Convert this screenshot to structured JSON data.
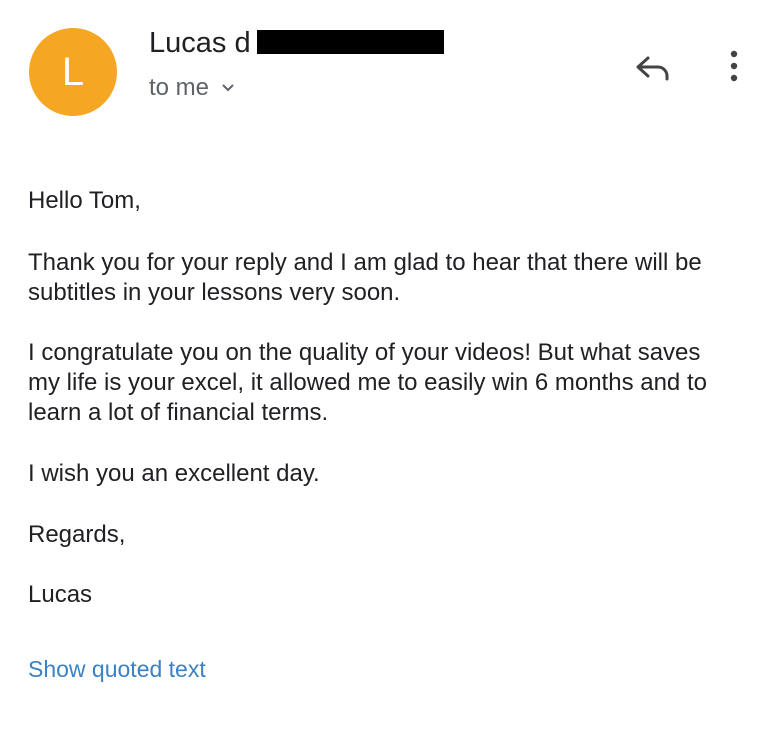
{
  "header": {
    "avatar_letter": "L",
    "avatar_color": "#f5a623",
    "sender_name_visible": "Lucas d",
    "recipient_label": "to me",
    "reply_icon": "reply-icon",
    "more_icon": "more-vertical-icon",
    "chevron_icon": "chevron-down-icon"
  },
  "message": {
    "greeting": "Hello Tom,",
    "paragraphs": [
      "Thank you for your reply and I am glad to hear that there will be subtitles in your lessons very soon.",
      "I congratulate you on the quality of your videos! But what saves my life is your excel, it allowed me to easily win 6 months and to learn a lot of financial terms.",
      "I wish you an excellent day.",
      "Regards,",
      "Lucas"
    ]
  },
  "footer": {
    "show_quoted_text": "Show quoted text",
    "link_color": "#3b82c4"
  }
}
